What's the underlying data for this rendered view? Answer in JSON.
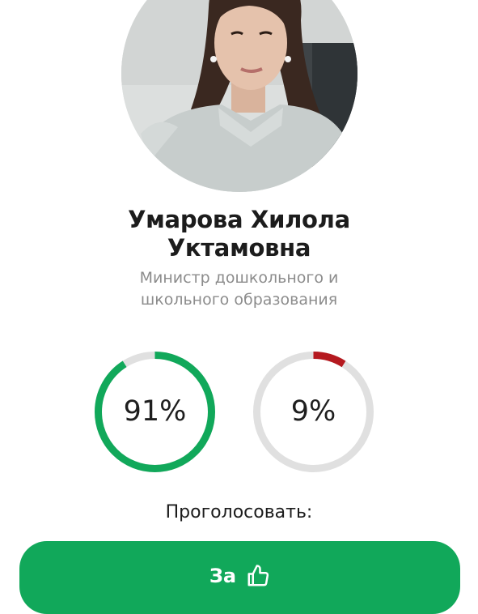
{
  "profile": {
    "avatar_alt": "portrait-photo",
    "name_line1": "Умарова Хилола",
    "name_line2": "Уктамовна",
    "role_line1": "Министр дошкольного и",
    "role_line2": "школьного образования"
  },
  "results": {
    "for_percent_text": "91%",
    "for_value": 91,
    "for_color": "#11a85a",
    "against_percent_text": "9%",
    "against_value": 9,
    "against_color": "#b5191f",
    "track_color": "#e0e0e0"
  },
  "vote": {
    "prompt": "Проголосовать:",
    "button_label": "За",
    "button_icon": "thumbs-up-icon",
    "button_color": "#11a85a"
  }
}
